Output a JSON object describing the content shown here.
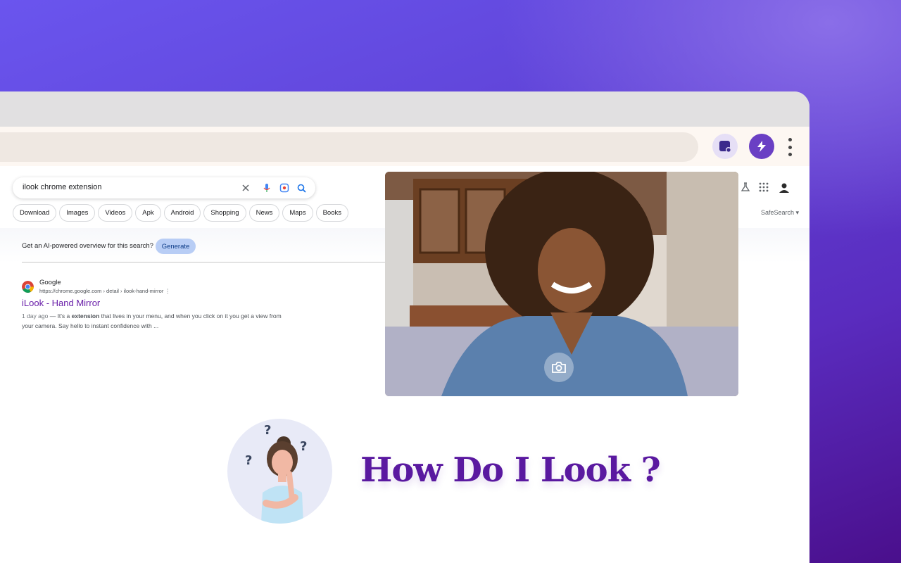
{
  "browser": {
    "extensions": [
      {
        "name": "mirror-extension-icon"
      },
      {
        "name": "lightning-extension-icon"
      }
    ]
  },
  "search": {
    "query": "ilook chrome extension",
    "chips": [
      "Download",
      "Images",
      "Videos",
      "Apk",
      "Android",
      "Shopping",
      "News",
      "Maps",
      "Books"
    ],
    "safesearch_label": "SafeSearch"
  },
  "ai_overview": {
    "prompt": "Get an AI-powered overview for this search?",
    "button_label": "Generate"
  },
  "result": {
    "site_name": "Google",
    "url": "https://chrome.google.com › detail › ilook-hand-mirror",
    "title": "iLook - Hand Mirror",
    "date": "1 day ago",
    "snippet_pre": " — It's a ",
    "snippet_bold": "extension",
    "snippet_post": " that lives in your menu, and when you click on it you get a view from your camera. Say hello to instant confidence with ..."
  },
  "promo": {
    "tagline": "How Do I Look ?"
  },
  "colors": {
    "accent": "#5a19a0",
    "result_title": "#681da8",
    "generate_bg": "#b8cdf5"
  }
}
